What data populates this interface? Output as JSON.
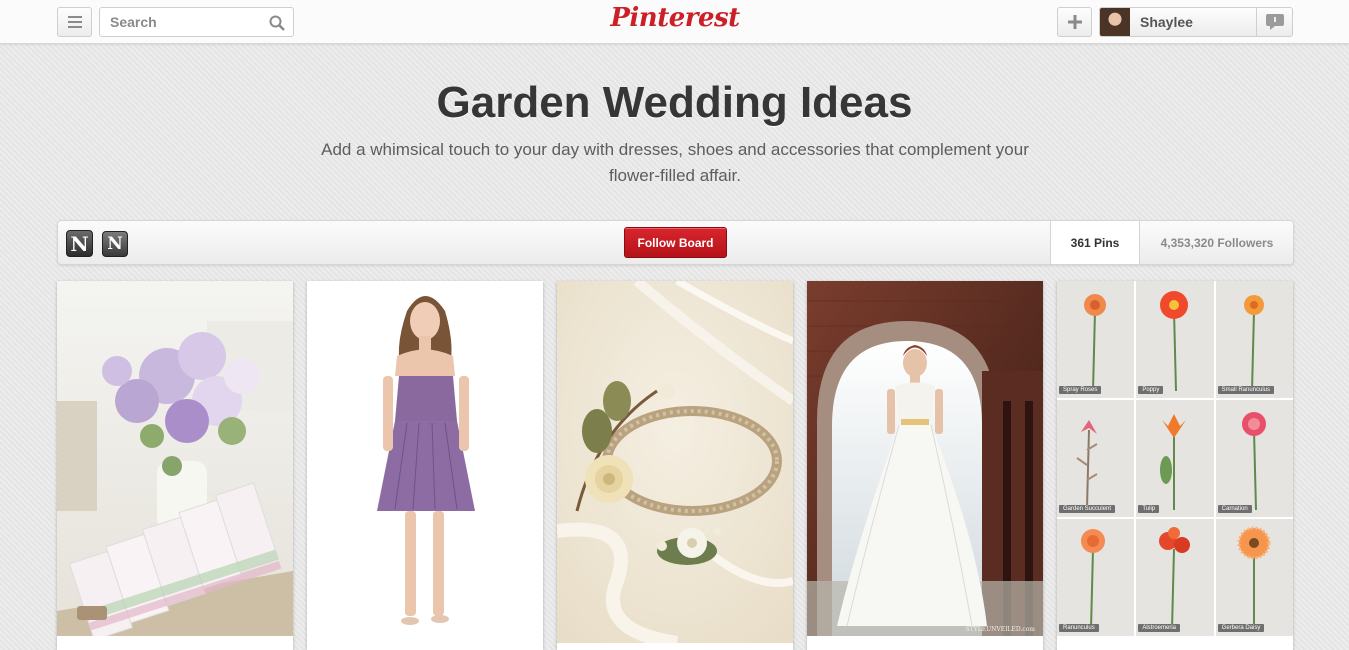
{
  "header": {
    "logo": "Pinterest",
    "search_placeholder": "Search",
    "username": "Shaylee",
    "icons": [
      "menu-icon",
      "search-icon",
      "plus-icon",
      "notifications-icon"
    ]
  },
  "board": {
    "title": "Garden Wedding Ideas",
    "description": "Add a whimsical touch to your day with dresses, shoes and accessories that complement your flower-filled affair.",
    "collaborators": [
      "N",
      "N"
    ],
    "follow_label": "Follow Board",
    "pins_count": "361 Pins",
    "followers_count": "4,353,320 Followers"
  },
  "pins": [
    {
      "kind": "floral-table",
      "desc": "…"
    },
    {
      "kind": "lavender-dress",
      "desc": ""
    },
    {
      "kind": "flower-crown",
      "desc": ""
    },
    {
      "kind": "bride-arch",
      "desc": "…",
      "watermark": "STYLEUNVEILED.com"
    },
    {
      "kind": "flower-chart",
      "desc": "…",
      "flowers": [
        "Spray Roses",
        "Poppy",
        "Small Ranunculus",
        "Garden Succulent",
        "Tulip",
        "Carnation",
        "Ranunculus",
        "Alstroemeria",
        "Gerbera Daisy"
      ]
    }
  ],
  "colors": {
    "brand": "#cb2027",
    "follow_button": "#c8171e"
  }
}
